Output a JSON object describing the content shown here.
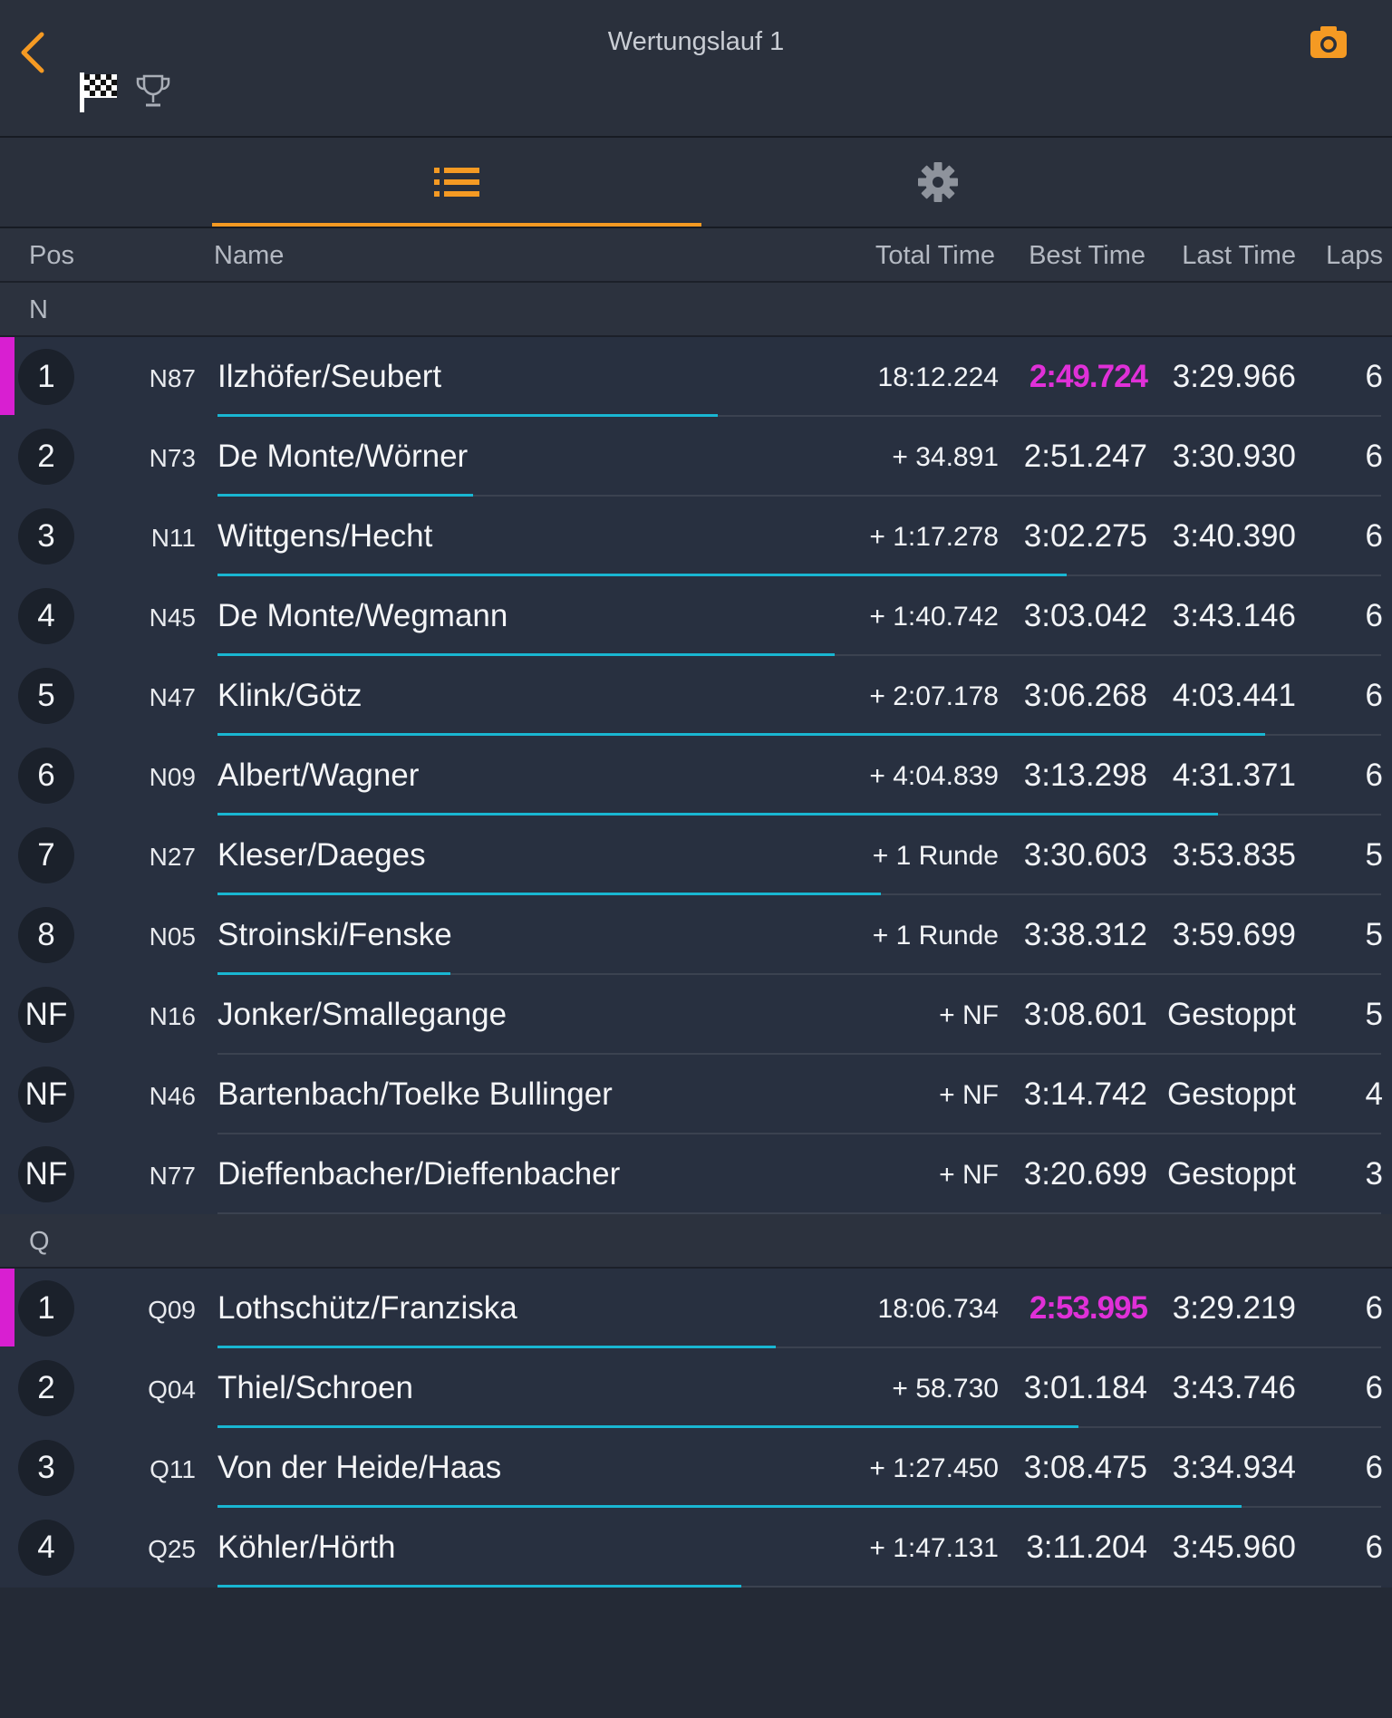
{
  "header": {
    "title": "Wertungslauf 1",
    "icons": [
      "back-chevron-icon",
      "checkered-flag-icon",
      "trophy-icon",
      "camera-icon"
    ],
    "accent_color": "#f59a23"
  },
  "tabs": [
    {
      "icon": "list-icon",
      "active": true
    },
    {
      "icon": "gear-icon",
      "active": false
    }
  ],
  "columns": {
    "pos": "Pos",
    "name": "Name",
    "total": "Total Time",
    "best": "Best Time",
    "last": "Last Time",
    "laps": "Laps"
  },
  "colors": {
    "leader": "#d81fd1",
    "best_highlight": "#e030d8",
    "progress": "#19b6d2"
  },
  "groups": [
    {
      "label": "N",
      "rows": [
        {
          "pos": "1",
          "num": "N87",
          "name": "Ilzhöfer/Seubert",
          "total": "18:12.224",
          "best": "2:49.724",
          "last": "3:29.966",
          "laps": "6",
          "leader": true,
          "best_highlight": true,
          "progress": 0.43
        },
        {
          "pos": "2",
          "num": "N73",
          "name": "De Monte/Wörner",
          "total": "+ 34.891",
          "best": "2:51.247",
          "last": "3:30.930",
          "laps": "6",
          "progress": 0.22
        },
        {
          "pos": "3",
          "num": "N11",
          "name": "Wittgens/Hecht",
          "total": "+ 1:17.278",
          "best": "3:02.275",
          "last": "3:40.390",
          "laps": "6",
          "progress": 0.73
        },
        {
          "pos": "4",
          "num": "N45",
          "name": "De Monte/Wegmann",
          "total": "+ 1:40.742",
          "best": "3:03.042",
          "last": "3:43.146",
          "laps": "6",
          "progress": 0.53
        },
        {
          "pos": "5",
          "num": "N47",
          "name": "Klink/Götz",
          "total": "+ 2:07.178",
          "best": "3:06.268",
          "last": "4:03.441",
          "laps": "6",
          "progress": 0.9
        },
        {
          "pos": "6",
          "num": "N09",
          "name": "Albert/Wagner",
          "total": "+ 4:04.839",
          "best": "3:13.298",
          "last": "4:31.371",
          "laps": "6",
          "progress": 0.86
        },
        {
          "pos": "7",
          "num": "N27",
          "name": "Kleser/Daeges",
          "total": "+ 1 Runde",
          "best": "3:30.603",
          "last": "3:53.835",
          "laps": "5",
          "progress": 0.57
        },
        {
          "pos": "8",
          "num": "N05",
          "name": "Stroinski/Fenske",
          "total": "+ 1 Runde",
          "best": "3:38.312",
          "last": "3:59.699",
          "laps": "5",
          "progress": 0.2
        },
        {
          "pos": "NF",
          "num": "N16",
          "name": "Jonker/Smallegange",
          "total": "+ NF",
          "best": "3:08.601",
          "last": "Gestoppt",
          "laps": "5",
          "progress": 0
        },
        {
          "pos": "NF",
          "num": "N46",
          "name": "Bartenbach/Toelke Bullinger",
          "total": "+ NF",
          "best": "3:14.742",
          "last": "Gestoppt",
          "laps": "4",
          "progress": 0
        },
        {
          "pos": "NF",
          "num": "N77",
          "name": "Dieffenbacher/Dieffenbacher",
          "total": "+ NF",
          "best": "3:20.699",
          "last": "Gestoppt",
          "laps": "3",
          "progress": 0
        }
      ]
    },
    {
      "label": "Q",
      "rows": [
        {
          "pos": "1",
          "num": "Q09",
          "name": "Lothschütz/Franziska",
          "total": "18:06.734",
          "best": "2:53.995",
          "last": "3:29.219",
          "laps": "6",
          "leader": true,
          "best_highlight": true,
          "progress": 0.48
        },
        {
          "pos": "2",
          "num": "Q04",
          "name": "Thiel/Schroen",
          "total": "+ 58.730",
          "best": "3:01.184",
          "last": "3:43.746",
          "laps": "6",
          "progress": 0.74
        },
        {
          "pos": "3",
          "num": "Q11",
          "name": "Von der Heide/Haas",
          "total": "+ 1:27.450",
          "best": "3:08.475",
          "last": "3:34.934",
          "laps": "6",
          "progress": 0.88
        },
        {
          "pos": "4",
          "num": "Q25",
          "name": "Köhler/Hörth",
          "total": "+ 1:47.131",
          "best": "3:11.204",
          "last": "3:45.960",
          "laps": "6",
          "progress": 0.45
        }
      ]
    }
  ]
}
